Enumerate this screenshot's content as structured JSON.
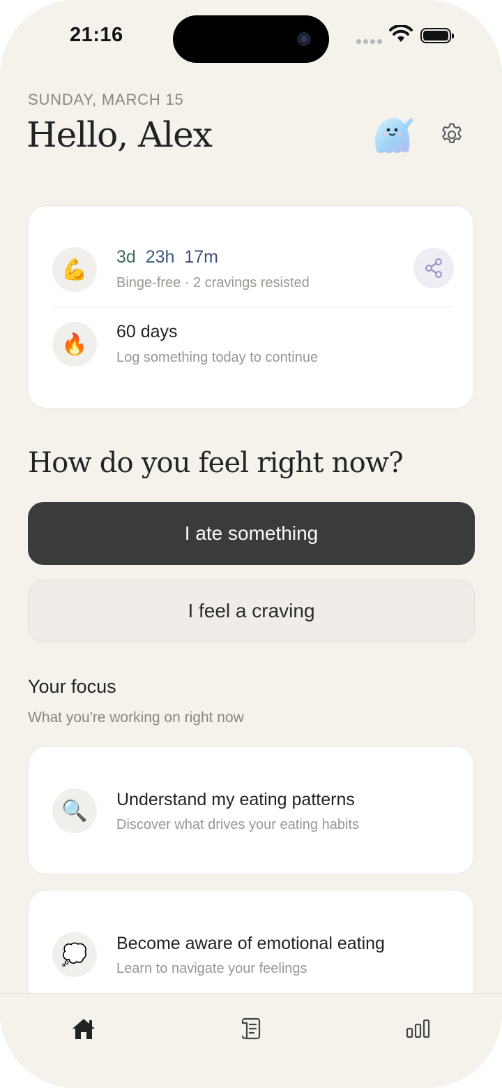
{
  "status_bar": {
    "time": "21:16"
  },
  "header": {
    "date": "SUNDAY, MARCH 15",
    "greeting": "Hello, Alex"
  },
  "streak_card": {
    "timer": {
      "days": "3d",
      "hours": "23h",
      "minutes": "17m"
    },
    "binge_free_subtitle": "Binge-free · 2 cravings resisted",
    "streak_title": "60 days",
    "streak_subtitle": "Log something today to continue",
    "icons": {
      "strength": "💪",
      "fire": "🔥"
    }
  },
  "prompt": {
    "question": "How do you feel right now?",
    "ate_button": "I ate something",
    "craving_button": "I feel a craving"
  },
  "focus": {
    "title": "Your focus",
    "subtitle": "What you're working on right now",
    "items": [
      {
        "icon": "🔍",
        "title": "Understand my eating patterns",
        "subtitle": "Discover what drives your eating habits"
      },
      {
        "icon": "💭",
        "title": "Become aware of emotional eating",
        "subtitle": "Learn to navigate your feelings"
      }
    ]
  },
  "tab_bar": {
    "tabs": [
      "home-icon",
      "journal-icon",
      "stats-icon"
    ]
  },
  "colors": {
    "background": "#f5f2ec",
    "primary_button": "#3b3b3b",
    "timer_days": "#3f6e55",
    "timer_hours": "#3e5a83",
    "accent_share": "#9b8cc9"
  }
}
